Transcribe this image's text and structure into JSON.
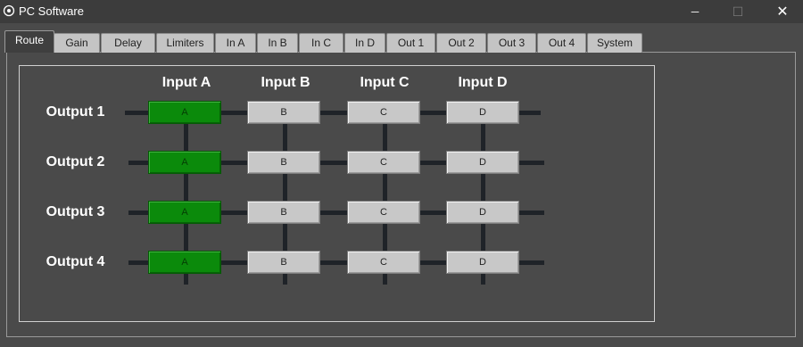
{
  "window": {
    "title": "PC Software",
    "minimize_glyph": "─",
    "maximize_glyph": "☐",
    "close_glyph": "✕"
  },
  "tabs": [
    {
      "label": "Route",
      "active": true
    },
    {
      "label": "Gain"
    },
    {
      "label": "Delay"
    },
    {
      "label": "Limiters"
    },
    {
      "label": "In A"
    },
    {
      "label": "In B"
    },
    {
      "label": "In C"
    },
    {
      "label": "In D"
    },
    {
      "label": "Out 1"
    },
    {
      "label": "Out 2"
    },
    {
      "label": "Out 3"
    },
    {
      "label": "Out 4"
    },
    {
      "label": "System"
    }
  ],
  "matrix": {
    "inputs": [
      "Input A",
      "Input B",
      "Input C",
      "Input D"
    ],
    "outputs": [
      "Output 1",
      "Output 2",
      "Output 3",
      "Output 4"
    ],
    "button_labels": [
      "A",
      "B",
      "C",
      "D"
    ],
    "routing": [
      [
        true,
        false,
        false,
        false
      ],
      [
        true,
        false,
        false,
        false
      ],
      [
        true,
        false,
        false,
        false
      ],
      [
        true,
        false,
        false,
        false
      ]
    ]
  },
  "colors": {
    "active_route": "#0b8a0b",
    "inactive_route": "#c8c8c8"
  }
}
